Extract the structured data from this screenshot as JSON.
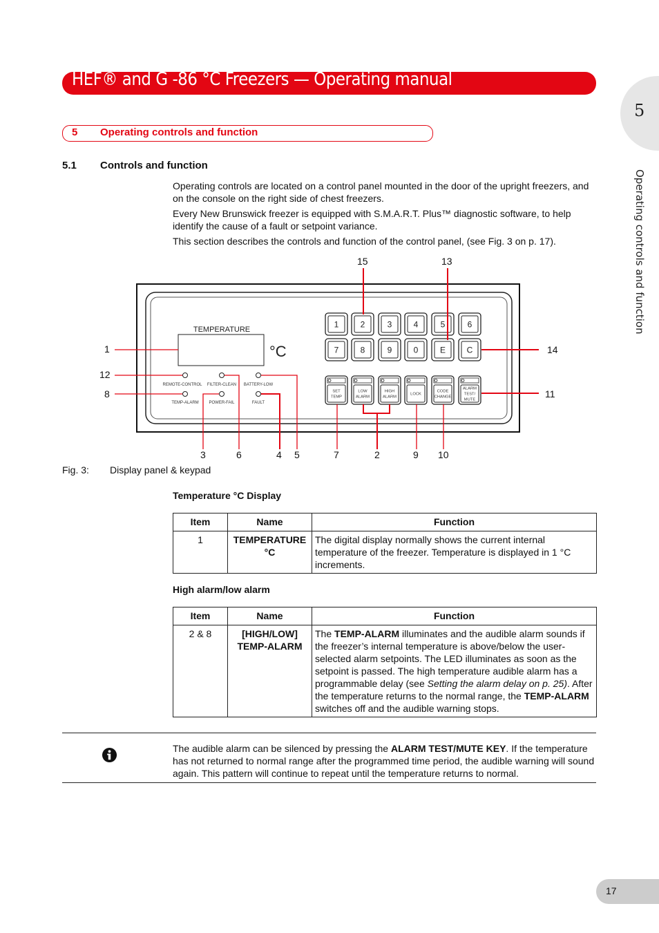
{
  "header": {
    "title": "HEF® and G -86 °C Freezers  —  Operating manual"
  },
  "chapter_tab": {
    "number": "5",
    "side_title": "Operating controls and function"
  },
  "section": {
    "number": "5",
    "title": "Operating controls and function"
  },
  "subsection": {
    "number": "5.1",
    "title": "Controls and function"
  },
  "paragraphs": [
    "Operating controls are located on a control panel mounted in the door of the upright freezers, and on the console on the right side of chest freezers.",
    "Every New Brunswick freezer is equipped with S.M.A.R.T. Plus™ diagnostic software, to help identify the cause of a fault or setpoint variance.",
    "This section describes the controls and function of the control panel, (see Fig. 3 on p. 17)."
  ],
  "figure": {
    "caption_label": "Fig. 3:",
    "caption_text": "Display panel & keypad",
    "display_label": "TEMPERATURE",
    "unit_symbol": "°C",
    "leds": [
      {
        "label": "REMOTE-CONTROL"
      },
      {
        "label": "FILTER-CLEAN"
      },
      {
        "label": "BATTERY-LOW"
      },
      {
        "label": "TEMP-ALARM"
      },
      {
        "label": "POWER-FAIL"
      },
      {
        "label": "FAULT"
      }
    ],
    "keypad_row1": [
      "1",
      "2",
      "3",
      "4",
      "5",
      "6"
    ],
    "keypad_row2": [
      "7",
      "8",
      "9",
      "0",
      "E",
      "C"
    ],
    "function_keys": [
      {
        "line1": "SET",
        "line2": "TEMP",
        "line3": ""
      },
      {
        "line1": "LOW",
        "line2": "ALARM",
        "line3": ""
      },
      {
        "line1": "HIGH",
        "line2": "ALARM",
        "line3": ""
      },
      {
        "line1": "LOCK",
        "line2": "",
        "line3": ""
      },
      {
        "line1": "CODE",
        "line2": "CHANGE",
        "line3": ""
      },
      {
        "line1": "ALARM",
        "line2": "TEST/",
        "line3": "MUTE"
      }
    ],
    "callouts": {
      "c1": "1",
      "c2": "2",
      "c3": "3",
      "c4": "4",
      "c5": "5",
      "c6": "6",
      "c7": "7",
      "c8": "8",
      "c9": "9",
      "c10": "10",
      "c11": "11",
      "c12": "12",
      "c13": "13",
      "c14": "14",
      "c15": "15"
    }
  },
  "table1": {
    "title": "Temperature °C Display",
    "headers": [
      "Item",
      "Name",
      "Function"
    ],
    "rows": [
      {
        "item": "1",
        "name_line1": "TEMPERATURE",
        "name_line2": "°C",
        "function": "The digital display normally shows the current internal temperature of the freezer. Temperature is displayed in 1 °C increments."
      }
    ]
  },
  "table2": {
    "title": "High alarm/low alarm",
    "headers": [
      "Item",
      "Name",
      "Function"
    ],
    "rows": [
      {
        "item": "2 & 8",
        "name_line1": "[HIGH/LOW]",
        "name_line2": "TEMP-ALARM",
        "function_parts": {
          "p1": "The ",
          "b1": "TEMP-ALARM",
          "p2": " illuminates and the audible alarm sounds if the freezer’s internal temperature is above/below the user-selected alarm setpoints. The LED illuminates as soon as the setpoint is passed. The high temperature audible alarm has a programmable delay (see ",
          "i1": "Setting the alarm delay on p. 25)",
          "p3": ". After the temperature returns to the normal range, the ",
          "b2": "TEMP-ALARM",
          "p4": " switches off and the audible warning stops."
        }
      }
    ]
  },
  "note": {
    "icon": "info-icon",
    "p1": "The audible alarm can be silenced by pressing the ",
    "b1": "ALARM TEST/MUTE KEY",
    "p2": ". If the temperature has not returned to normal range after the programmed time period, the audible warning will sound again. This pattern will continue to repeat until the temperature returns to normal."
  },
  "page": {
    "number": "17"
  },
  "colors": {
    "accent": "#e30613",
    "tab_gray": "#e6e6e6",
    "page_tab_gray": "#cccccc"
  }
}
